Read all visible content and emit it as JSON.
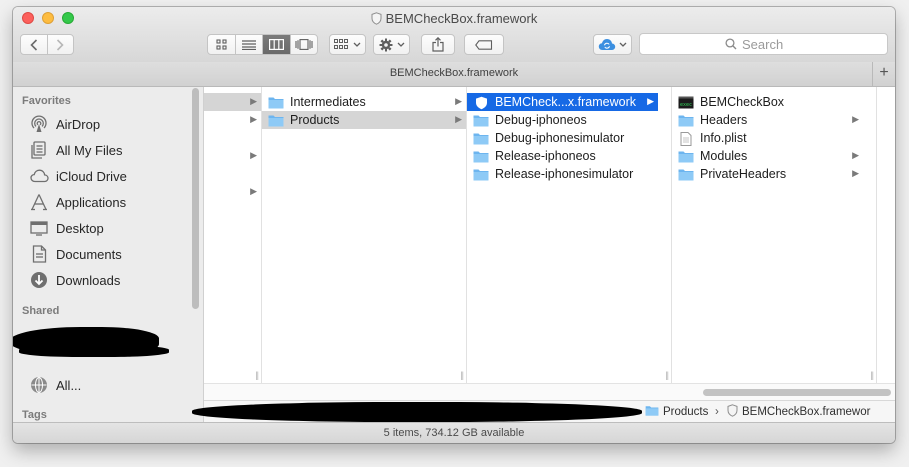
{
  "window": {
    "title": "BEMCheckBox.framework"
  },
  "toolbar": {
    "search_placeholder": "Search",
    "back_icon": "chevron-left-icon",
    "forward_icon": "chevron-right-icon",
    "view_modes": [
      "icon-view-icon",
      "list-view-icon",
      "column-view-icon",
      "cover-flow-icon"
    ],
    "active_view": "column-view-icon"
  },
  "pathbar": {
    "title": "BEMCheckBox.framework",
    "add_tab": "+"
  },
  "sidebar": {
    "favorites_heading": "Favorites",
    "favorites": [
      {
        "label": "AirDrop",
        "icon": "airdrop-icon"
      },
      {
        "label": "All My Files",
        "icon": "all-files-icon"
      },
      {
        "label": "iCloud Drive",
        "icon": "icloud-icon"
      },
      {
        "label": "Applications",
        "icon": "applications-icon"
      },
      {
        "label": "Desktop",
        "icon": "desktop-icon"
      },
      {
        "label": "Documents",
        "icon": "documents-icon"
      },
      {
        "label": "Downloads",
        "icon": "downloads-icon"
      }
    ],
    "shared_heading": "Shared",
    "shared_all": "All...",
    "tags_heading": "Tags"
  },
  "columns": {
    "col2": [
      {
        "label": "Intermediates",
        "selected": false
      },
      {
        "label": "Products",
        "selected": true
      }
    ],
    "col3": [
      {
        "label": "BEMCheck...x.framework",
        "selected": true
      },
      {
        "label": "Debug-iphoneos"
      },
      {
        "label": "Debug-iphonesimulator"
      },
      {
        "label": "Release-iphoneos"
      },
      {
        "label": "Release-iphonesimulator"
      }
    ],
    "col4": [
      {
        "label": "BEMCheckBox",
        "icon": "executable-icon"
      },
      {
        "label": "Headers",
        "icon": "folder-icon"
      },
      {
        "label": "Info.plist",
        "icon": "plist-file-icon"
      },
      {
        "label": "Modules",
        "icon": "folder-icon"
      },
      {
        "label": "PrivateHeaders",
        "icon": "folder-icon"
      }
    ]
  },
  "path": {
    "products": "Products",
    "sep": "›",
    "framework": "BEMCheckBox.framewor"
  },
  "status": {
    "text": "5 items, 734.12 GB available"
  },
  "colors": {
    "selection_blue": "#1669e5",
    "folder_blue": "#6db5ef"
  }
}
